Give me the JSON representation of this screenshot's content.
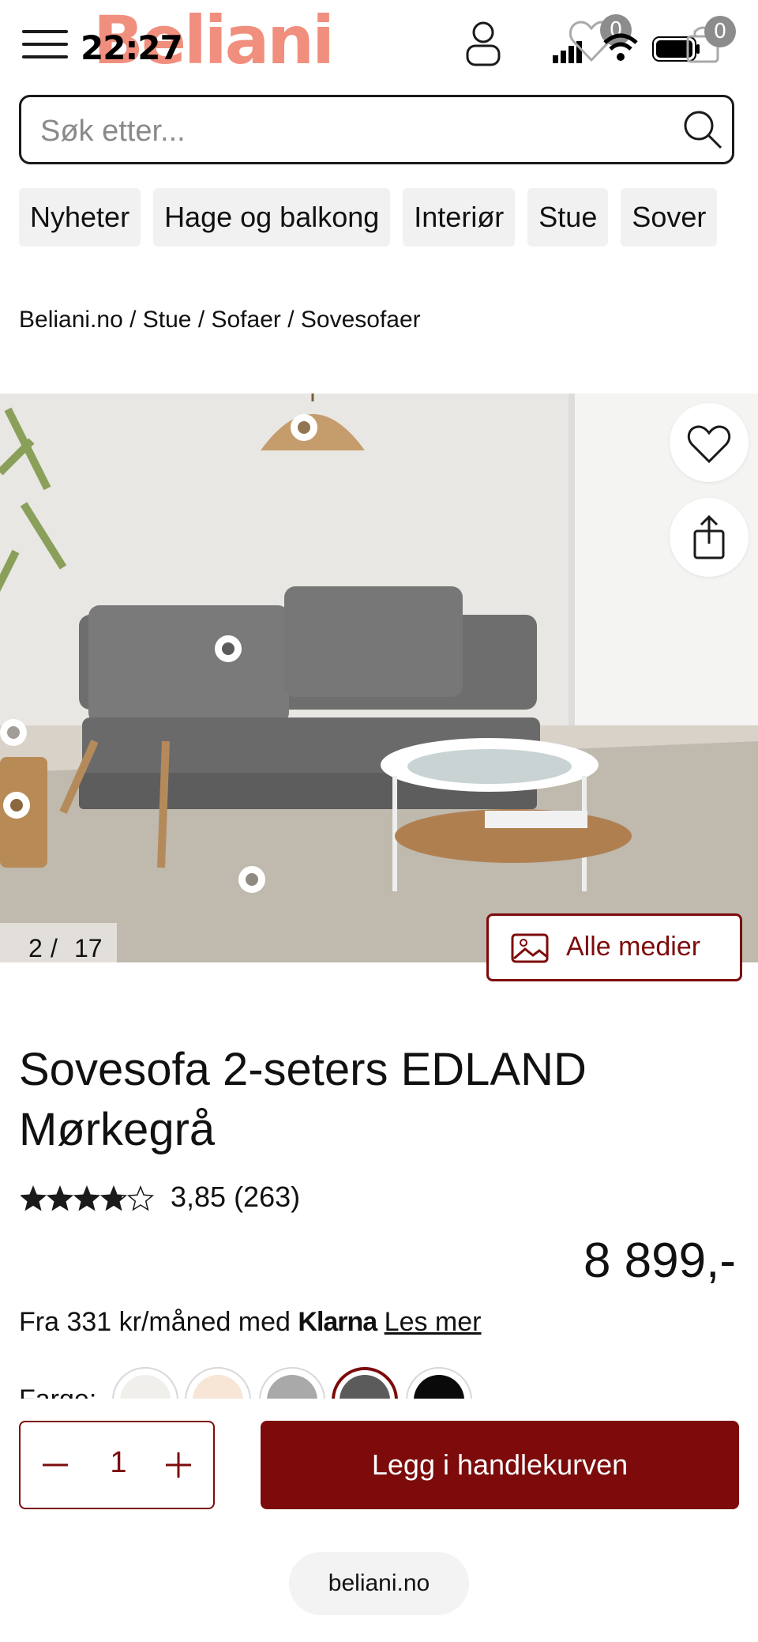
{
  "status_bar": {
    "time": "22:27"
  },
  "header": {
    "logo_text": "Beliani",
    "wishlist_count": "0",
    "cart_count": "0",
    "logo_color": "#f08a78"
  },
  "search": {
    "placeholder": "Søk etter..."
  },
  "categories": [
    "Nyheter",
    "Hage og balkong",
    "Interiør",
    "Stue",
    "Sover"
  ],
  "breadcrumb": "Beliani.no / Stue / Sofaer / Sovesofaer",
  "gallery": {
    "current": "2",
    "separator": "/",
    "total": "17",
    "all_media_label": "Alle medier"
  },
  "product": {
    "title": "Sovesofa 2-seters EDLAND Mørkegrå",
    "rating_value": 3.85,
    "rating_text": "3,85 (263)",
    "price": "8 899,-",
    "financing_prefix": "Fra 331 kr/måned med",
    "financing_brand": "Klarna",
    "financing_link": "Les mer"
  },
  "colors": {
    "label": "Farge:",
    "swatches": [
      "#f0efec",
      "#f7e6d6",
      "#a9a9a9",
      "#5b5b5b",
      "#0a0a0a"
    ],
    "selected_index": 3
  },
  "cart": {
    "quantity": "1",
    "add_to_cart_label": "Legg i handlekurven",
    "accent": "#7d0b0b"
  },
  "browser": {
    "url": "beliani.no"
  }
}
